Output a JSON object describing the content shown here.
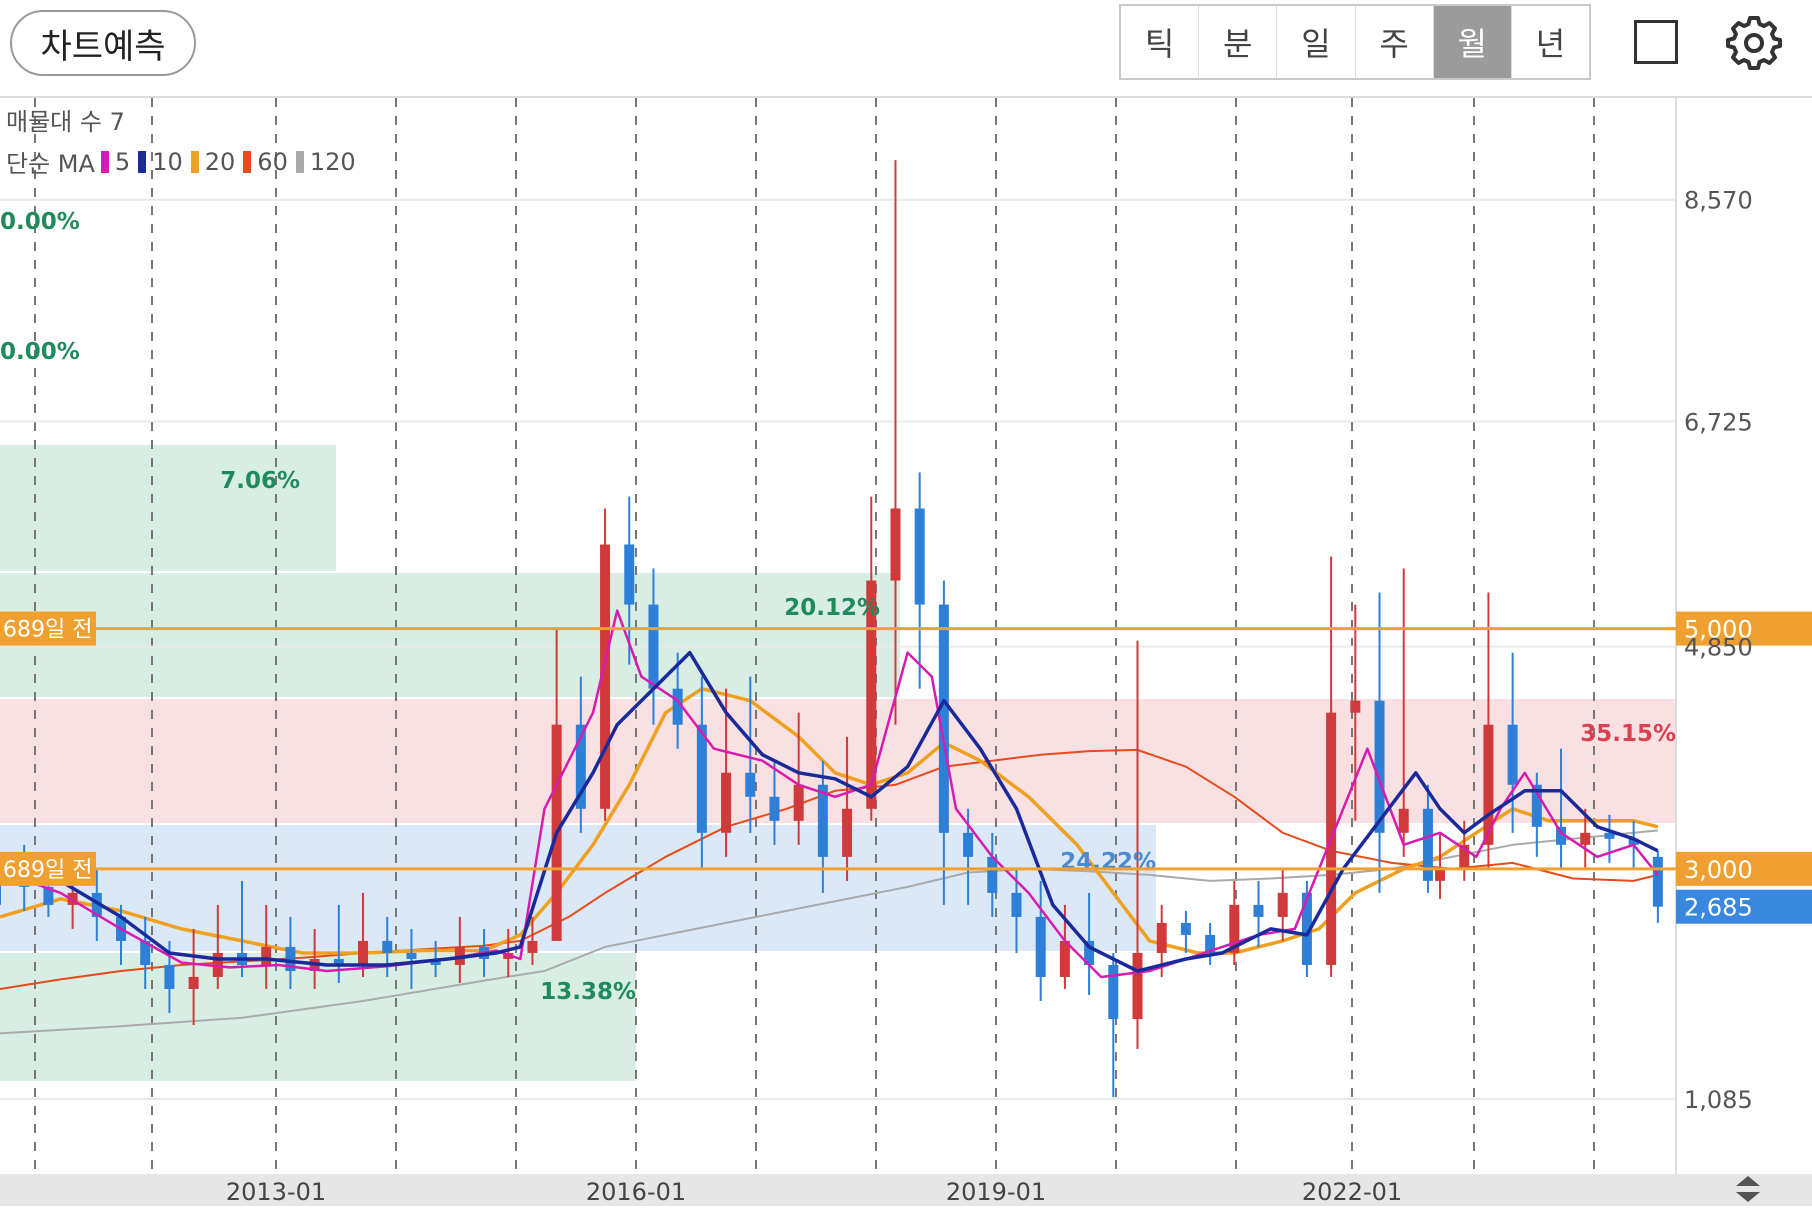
{
  "toolbar": {
    "predict_label": "차트예측",
    "periods": [
      "틱",
      "분",
      "일",
      "주",
      "월",
      "년"
    ],
    "active_period": "월"
  },
  "legend": {
    "volume_profile_label": "매물대 수 7",
    "ma_label": "단순 MA",
    "ma_periods": [
      {
        "label": "5",
        "color": "#d81bb0"
      },
      {
        "label": "10",
        "color": "#1a2a9a"
      },
      {
        "label": "20",
        "color": "#f0a020"
      },
      {
        "label": "60",
        "color": "#e84a1a"
      },
      {
        "label": "120",
        "color": "#aaaaaa"
      }
    ]
  },
  "chart_data": {
    "type": "candlestick",
    "x_ticks": [
      "2013-01",
      "2016-01",
      "2019-01",
      "2022-01"
    ],
    "y_ticks": [
      "8,570",
      "6,725",
      "4,850",
      "1,085"
    ],
    "ylim": [
      460,
      9400
    ],
    "grid": "dashed vertical lines",
    "price_markers": [
      {
        "label": "689일 전",
        "price": 5000,
        "price_label": "5,000",
        "color": "#f0a030"
      },
      {
        "label": "689일 전",
        "price": 3000,
        "price_label": "3,000",
        "color": "#f0a030"
      }
    ],
    "current_price": {
      "price": 2685,
      "label": "2,685",
      "color": "#3a87e0"
    },
    "volume_profile": [
      {
        "percent": "0.00%"
      },
      {
        "percent": "0.00%"
      },
      {
        "percent": "7.06%"
      },
      {
        "percent": "20.12%"
      },
      {
        "percent": "35.15%"
      },
      {
        "percent": "24.22%"
      },
      {
        "percent": "13.38%"
      }
    ],
    "ma5": [
      [
        2011.0,
        2980
      ],
      [
        2011.5,
        2800
      ],
      [
        2012.0,
        2500
      ],
      [
        2012.5,
        2220
      ],
      [
        2012.9,
        2180
      ],
      [
        2013.3,
        2200
      ],
      [
        2013.7,
        2150
      ],
      [
        2014.2,
        2190
      ],
      [
        2014.7,
        2250
      ],
      [
        2015.1,
        2320
      ],
      [
        2015.3,
        2250
      ],
      [
        2015.5,
        3500
      ],
      [
        2015.7,
        3900
      ],
      [
        2015.9,
        4300
      ],
      [
        2016.1,
        5150
      ],
      [
        2016.3,
        4600
      ],
      [
        2016.6,
        4400
      ],
      [
        2016.9,
        4000
      ],
      [
        2017.3,
        3900
      ],
      [
        2017.6,
        3700
      ],
      [
        2017.9,
        3600
      ],
      [
        2018.2,
        3700
      ],
      [
        2018.5,
        4800
      ],
      [
        2018.7,
        4600
      ],
      [
        2018.9,
        3500
      ],
      [
        2019.2,
        3100
      ],
      [
        2019.5,
        2800
      ],
      [
        2019.8,
        2400
      ],
      [
        2020.1,
        2100
      ],
      [
        2020.5,
        2150
      ],
      [
        2020.8,
        2250
      ],
      [
        2021.1,
        2350
      ],
      [
        2021.4,
        2450
      ],
      [
        2021.7,
        2500
      ],
      [
        2021.9,
        3000
      ],
      [
        2022.1,
        3500
      ],
      [
        2022.3,
        4000
      ],
      [
        2022.6,
        3200
      ],
      [
        2022.9,
        3300
      ],
      [
        2023.2,
        3100
      ],
      [
        2023.4,
        3500
      ],
      [
        2023.6,
        3800
      ],
      [
        2023.9,
        3300
      ],
      [
        2024.2,
        3100
      ],
      [
        2024.5,
        3200
      ],
      [
        2024.7,
        2950
      ]
    ],
    "ma10": [
      [
        2011.0,
        3000
      ],
      [
        2011.5,
        2900
      ],
      [
        2012.0,
        2600
      ],
      [
        2012.4,
        2300
      ],
      [
        2012.8,
        2250
      ],
      [
        2013.2,
        2250
      ],
      [
        2013.7,
        2200
      ],
      [
        2014.2,
        2200
      ],
      [
        2014.7,
        2250
      ],
      [
        2015.1,
        2300
      ],
      [
        2015.3,
        2350
      ],
      [
        2015.6,
        3300
      ],
      [
        2015.9,
        3800
      ],
      [
        2016.1,
        4200
      ],
      [
        2016.4,
        4500
      ],
      [
        2016.7,
        4800
      ],
      [
        2017.0,
        4300
      ],
      [
        2017.3,
        3950
      ],
      [
        2017.6,
        3800
      ],
      [
        2017.9,
        3750
      ],
      [
        2018.2,
        3600
      ],
      [
        2018.5,
        3850
      ],
      [
        2018.8,
        4400
      ],
      [
        2019.1,
        4000
      ],
      [
        2019.4,
        3500
      ],
      [
        2019.7,
        2700
      ],
      [
        2020.0,
        2350
      ],
      [
        2020.4,
        2150
      ],
      [
        2020.8,
        2250
      ],
      [
        2021.1,
        2300
      ],
      [
        2021.5,
        2500
      ],
      [
        2021.8,
        2450
      ],
      [
        2022.1,
        3000
      ],
      [
        2022.4,
        3400
      ],
      [
        2022.7,
        3800
      ],
      [
        2022.9,
        3500
      ],
      [
        2023.1,
        3300
      ],
      [
        2023.3,
        3450
      ],
      [
        2023.6,
        3650
      ],
      [
        2023.9,
        3650
      ],
      [
        2024.2,
        3350
      ],
      [
        2024.5,
        3250
      ],
      [
        2024.7,
        3150
      ]
    ],
    "ma20": [
      [
        2011.0,
        2600
      ],
      [
        2011.5,
        2750
      ],
      [
        2012.0,
        2650
      ],
      [
        2012.5,
        2500
      ],
      [
        2013.0,
        2400
      ],
      [
        2013.5,
        2300
      ],
      [
        2014.0,
        2300
      ],
      [
        2014.5,
        2320
      ],
      [
        2015.0,
        2320
      ],
      [
        2015.3,
        2450
      ],
      [
        2015.6,
        2800
      ],
      [
        2015.9,
        3200
      ],
      [
        2016.2,
        3700
      ],
      [
        2016.5,
        4300
      ],
      [
        2016.8,
        4500
      ],
      [
        2017.2,
        4400
      ],
      [
        2017.6,
        4100
      ],
      [
        2017.9,
        3800
      ],
      [
        2018.2,
        3700
      ],
      [
        2018.5,
        3800
      ],
      [
        2018.8,
        4050
      ],
      [
        2019.1,
        3900
      ],
      [
        2019.5,
        3600
      ],
      [
        2019.9,
        3200
      ],
      [
        2020.2,
        2800
      ],
      [
        2020.5,
        2400
      ],
      [
        2020.9,
        2300
      ],
      [
        2021.2,
        2300
      ],
      [
        2021.6,
        2400
      ],
      [
        2021.9,
        2500
      ],
      [
        2022.2,
        2800
      ],
      [
        2022.6,
        3000
      ],
      [
        2022.9,
        3100
      ],
      [
        2023.2,
        3300
      ],
      [
        2023.5,
        3500
      ],
      [
        2023.8,
        3400
      ],
      [
        2024.2,
        3400
      ],
      [
        2024.5,
        3400
      ],
      [
        2024.7,
        3350
      ]
    ],
    "ma60": [
      [
        2011.0,
        2000
      ],
      [
        2011.5,
        2080
      ],
      [
        2012.0,
        2150
      ],
      [
        2012.5,
        2200
      ],
      [
        2013.0,
        2230
      ],
      [
        2013.5,
        2260
      ],
      [
        2014.0,
        2300
      ],
      [
        2014.5,
        2330
      ],
      [
        2015.0,
        2360
      ],
      [
        2015.3,
        2400
      ],
      [
        2015.7,
        2600
      ],
      [
        2016.0,
        2800
      ],
      [
        2016.5,
        3100
      ],
      [
        2017.0,
        3350
      ],
      [
        2017.5,
        3500
      ],
      [
        2017.9,
        3650
      ],
      [
        2018.4,
        3700
      ],
      [
        2018.8,
        3850
      ],
      [
        2019.2,
        3900
      ],
      [
        2019.6,
        3950
      ],
      [
        2020.0,
        3980
      ],
      [
        2020.4,
        3990
      ],
      [
        2020.8,
        3850
      ],
      [
        2021.2,
        3600
      ],
      [
        2021.6,
        3300
      ],
      [
        2022.0,
        3150
      ],
      [
        2022.5,
        3050
      ],
      [
        2023.0,
        3000
      ],
      [
        2023.5,
        3050
      ],
      [
        2024.0,
        2920
      ],
      [
        2024.5,
        2900
      ],
      [
        2024.7,
        2950
      ]
    ],
    "ma120": [
      [
        2011.0,
        1630
      ],
      [
        2012.0,
        1690
      ],
      [
        2013.0,
        1760
      ],
      [
        2014.0,
        1900
      ],
      [
        2015.0,
        2070
      ],
      [
        2015.5,
        2150
      ],
      [
        2016.0,
        2350
      ],
      [
        2016.5,
        2450
      ],
      [
        2017.0,
        2550
      ],
      [
        2017.5,
        2650
      ],
      [
        2018.0,
        2750
      ],
      [
        2018.5,
        2850
      ],
      [
        2019.0,
        2970
      ],
      [
        2019.5,
        3000
      ],
      [
        2020.0,
        2980
      ],
      [
        2020.5,
        2950
      ],
      [
        2021.0,
        2900
      ],
      [
        2021.5,
        2920
      ],
      [
        2022.0,
        2950
      ],
      [
        2022.5,
        3000
      ],
      [
        2023.0,
        3100
      ],
      [
        2023.5,
        3200
      ],
      [
        2024.0,
        3250
      ],
      [
        2024.5,
        3300
      ],
      [
        2024.7,
        3320
      ]
    ],
    "candles": [
      [
        2011.0,
        3000,
        2900,
        3100,
        2700
      ],
      [
        2011.2,
        2900,
        2850,
        3200,
        2650
      ],
      [
        2011.4,
        2850,
        2700,
        3000,
        2600
      ],
      [
        2011.6,
        2700,
        2800,
        3100,
        2500
      ],
      [
        2011.8,
        2800,
        2600,
        3000,
        2400
      ],
      [
        2012.0,
        2600,
        2400,
        2700,
        2200
      ],
      [
        2012.2,
        2400,
        2200,
        2600,
        2000
      ],
      [
        2012.4,
        2200,
        2000,
        2400,
        1800
      ],
      [
        2012.6,
        2000,
        2100,
        2500,
        1700
      ],
      [
        2012.8,
        2100,
        2300,
        2700,
        2000
      ],
      [
        2013.0,
        2300,
        2200,
        2900,
        2100
      ],
      [
        2013.2,
        2200,
        2350,
        2700,
        2000
      ],
      [
        2013.4,
        2350,
        2150,
        2600,
        2000
      ],
      [
        2013.6,
        2150,
        2250,
        2500,
        2000
      ],
      [
        2013.8,
        2250,
        2200,
        2700,
        2050
      ],
      [
        2014.0,
        2200,
        2400,
        2800,
        2100
      ],
      [
        2014.2,
        2400,
        2300,
        2600,
        2100
      ],
      [
        2014.4,
        2300,
        2250,
        2500,
        2000
      ],
      [
        2014.6,
        2250,
        2200,
        2400,
        2100
      ],
      [
        2014.8,
        2200,
        2350,
        2600,
        2050
      ],
      [
        2015.0,
        2350,
        2250,
        2500,
        2100
      ],
      [
        2015.2,
        2250,
        2300,
        2500,
        2100
      ],
      [
        2015.4,
        2300,
        2400,
        2600,
        2200
      ],
      [
        2015.6,
        2400,
        4200,
        5000,
        2500
      ],
      [
        2015.8,
        4200,
        3500,
        4600,
        3300
      ],
      [
        2016.0,
        3500,
        5700,
        6000,
        3400
      ],
      [
        2016.2,
        5700,
        5200,
        6100,
        4700
      ],
      [
        2016.4,
        5200,
        4500,
        5500,
        4200
      ],
      [
        2016.6,
        4500,
        4200,
        4800,
        4000
      ],
      [
        2016.8,
        4200,
        3300,
        4600,
        3000
      ],
      [
        2017.0,
        3300,
        3800,
        4500,
        3100
      ],
      [
        2017.2,
        3800,
        3600,
        4600,
        3300
      ],
      [
        2017.4,
        3600,
        3400,
        3900,
        3200
      ],
      [
        2017.6,
        3400,
        3700,
        4300,
        3200
      ],
      [
        2017.8,
        3700,
        3100,
        3900,
        2800
      ],
      [
        2018.0,
        3100,
        3500,
        4100,
        2900
      ],
      [
        2018.2,
        3500,
        5400,
        6100,
        3400
      ],
      [
        2018.4,
        5400,
        6000,
        8900,
        4200
      ],
      [
        2018.6,
        6000,
        5200,
        6300,
        4500
      ],
      [
        2018.8,
        5200,
        3300,
        5400,
        2700
      ],
      [
        2019.0,
        3300,
        3100,
        3500,
        2700
      ],
      [
        2019.2,
        3100,
        2800,
        3300,
        2600
      ],
      [
        2019.4,
        2800,
        2600,
        3000,
        2300
      ],
      [
        2019.6,
        2600,
        2100,
        2900,
        1900
      ],
      [
        2019.8,
        2100,
        2400,
        2700,
        2000
      ],
      [
        2020.0,
        2400,
        2200,
        2800,
        1950
      ],
      [
        2020.2,
        2200,
        1750,
        2300,
        1100
      ],
      [
        2020.4,
        1750,
        2300,
        4900,
        1500
      ],
      [
        2020.6,
        2300,
        2550,
        2700,
        2100
      ],
      [
        2020.8,
        2550,
        2450,
        2650,
        2300
      ],
      [
        2021.0,
        2450,
        2300,
        2550,
        2200
      ],
      [
        2021.2,
        2300,
        2700,
        2900,
        2200
      ],
      [
        2021.4,
        2700,
        2600,
        2900,
        2350
      ],
      [
        2021.6,
        2600,
        2800,
        3000,
        2400
      ],
      [
        2021.8,
        2800,
        2200,
        2900,
        2100
      ],
      [
        2022.0,
        2200,
        4300,
        5600,
        2100
      ],
      [
        2022.2,
        4300,
        4400,
        5200,
        3400
      ],
      [
        2022.4,
        4400,
        3300,
        5300,
        2800
      ],
      [
        2022.6,
        3300,
        3500,
        5500,
        3100
      ],
      [
        2022.8,
        3500,
        2900,
        3700,
        2800
      ],
      [
        2022.9,
        2900,
        3000,
        3300,
        2750
      ],
      [
        2023.1,
        3000,
        3200,
        3400,
        2900
      ],
      [
        2023.3,
        3200,
        4200,
        5300,
        3000
      ],
      [
        2023.5,
        4200,
        3700,
        4800,
        3300
      ],
      [
        2023.7,
        3700,
        3350,
        3800,
        3100
      ],
      [
        2023.9,
        3350,
        3200,
        4000,
        3000
      ],
      [
        2024.1,
        3200,
        3300,
        3500,
        3000
      ],
      [
        2024.3,
        3300,
        3250,
        3450,
        3050
      ],
      [
        2024.5,
        3250,
        3200,
        3400,
        3000
      ],
      [
        2024.7,
        3100,
        2685,
        3150,
        2550
      ]
    ]
  }
}
